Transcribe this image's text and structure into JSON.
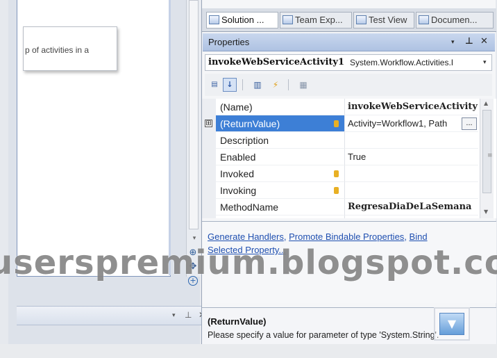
{
  "designer": {
    "tooltip_text": "p of activities in a"
  },
  "tabs": [
    {
      "label": "Solution ...",
      "icon": "solution-explorer-icon"
    },
    {
      "label": "Team Exp...",
      "icon": "team-explorer-icon"
    },
    {
      "label": "Test View",
      "icon": "test-view-icon"
    },
    {
      "label": "Documen...",
      "icon": "document-outline-icon"
    }
  ],
  "properties": {
    "title": "Properties",
    "header_controls": {
      "dropdown": "▾",
      "pin": "⊥",
      "close": "✕"
    },
    "object_name": "invokeWebServiceActivity1",
    "object_type": "System.Workflow.Activities.I",
    "object_chevron": "▾",
    "toolbar": {
      "categorized": "▤",
      "alphabetical": "↓",
      "property_pages": "▥",
      "events": "⚡",
      "pages": "▦"
    },
    "rows": [
      {
        "name": "(Name)",
        "value": "invokeWebServiceActivity",
        "bold": true
      },
      {
        "name": "(ReturnValue)",
        "value": "Activity=Workflow1, Path",
        "selected": true,
        "expander": "⊞",
        "ellipsis": "..."
      },
      {
        "name": "Description",
        "value": ""
      },
      {
        "name": "Enabled",
        "value": "True"
      },
      {
        "name": "Invoked",
        "value": "",
        "event": true
      },
      {
        "name": "Invoking",
        "value": "",
        "event": true
      },
      {
        "name": "MethodName",
        "value": "RegresaDiaDeLaSemana",
        "bold": true
      },
      {
        "name": "",
        "value": ""
      }
    ],
    "commands": {
      "links": [
        "Generate Handlers",
        "Promote Bindable Properties",
        "Bind Selected Property..."
      ],
      "separator": ","
    },
    "description": {
      "title": "(ReturnValue)",
      "text": "Please specify a value for parameter of type 'System.String'."
    }
  },
  "left_bottom_controls": {
    "dropdown": "▾",
    "pin": "⊥",
    "close": "✕"
  },
  "watermark": "userspremium.blogspot.com",
  "colors": {
    "selection": "#3d7fd6",
    "link": "#1f4fb0",
    "header": "#b8c9e6"
  }
}
